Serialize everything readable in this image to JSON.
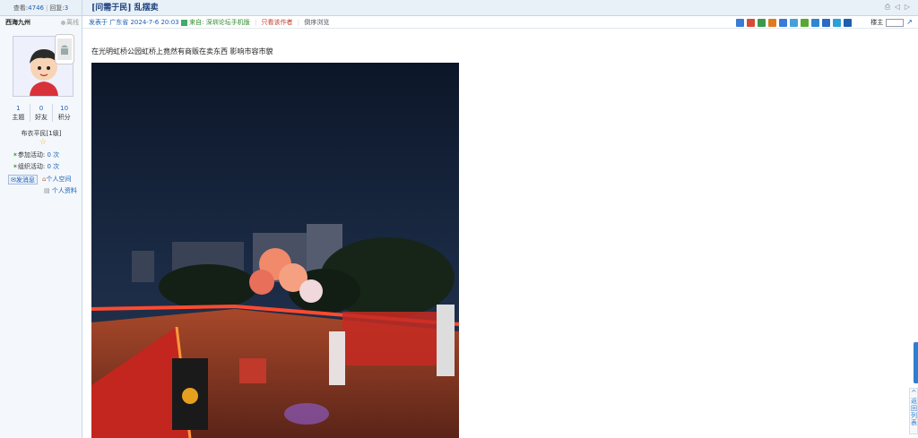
{
  "header": {
    "views_label": "查看:",
    "views": "4746",
    "replies_label": "回复:",
    "replies": "3",
    "thread_category": "[问需于民]",
    "thread_title": "乱摆卖"
  },
  "author": {
    "name": "西海九州",
    "status": "离线",
    "stats": [
      {
        "value": "1",
        "label": "主题"
      },
      {
        "value": "0",
        "label": "好友"
      },
      {
        "value": "10",
        "label": "积分"
      }
    ],
    "rank": "布衣平民[1级]",
    "activities": [
      {
        "label": "参加活动:",
        "value": "0 次"
      },
      {
        "label": "组织活动:",
        "value": "0 次"
      }
    ],
    "send_message": "发消息",
    "personal_space": "个人空间",
    "personal_profile": "个人资料"
  },
  "meta": {
    "posted_prefix": "发表于",
    "location": "广东省",
    "datetime": "2024-7-6 20:03",
    "source_label": "来自:",
    "source": "深圳论坛手机版",
    "only_author": "只看该作者",
    "reading_mode": "倒序浏览",
    "floor_label": "楼主"
  },
  "share_colors": [
    "#3a7bd5",
    "#d84a38",
    "#3a9a4a",
    "#e07a1f",
    "#3a7bd5",
    "#46a0d8",
    "#5aa832",
    "#2f86d0",
    "#2b6bc2",
    "#2aa0d8",
    "#1f5fb0"
  ],
  "post": {
    "text": "在光明虹桥公园虹桥上竟然有商贩在卖东西  影响市容市貌"
  },
  "sidebar_tools": {
    "back_to_top": "返回列表"
  }
}
